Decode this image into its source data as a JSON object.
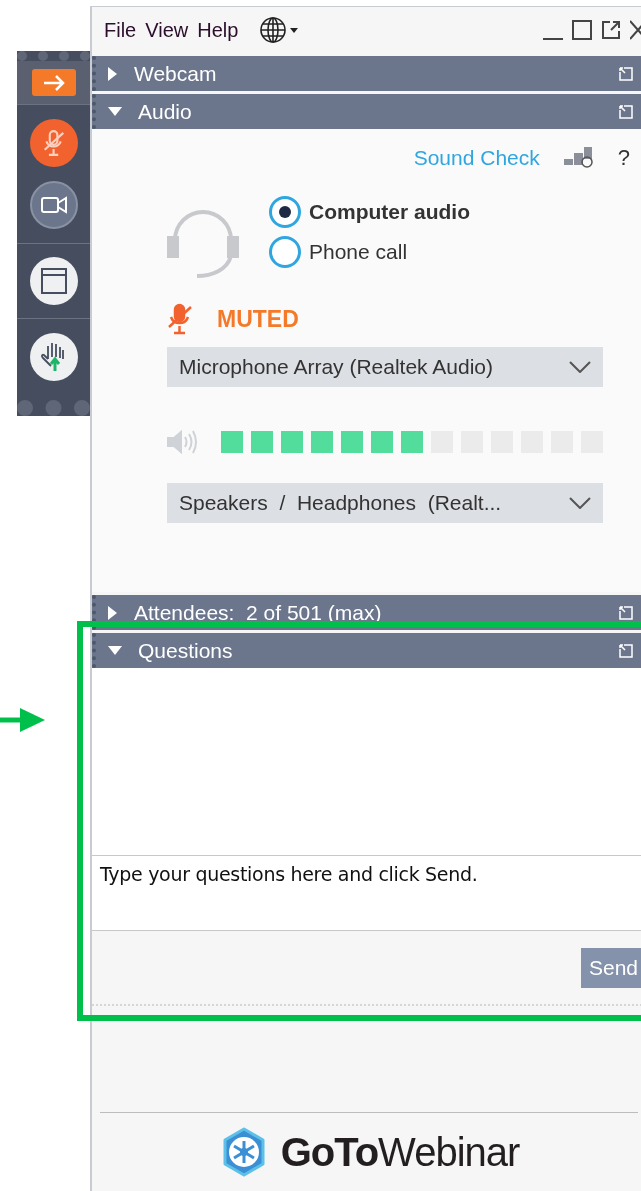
{
  "menu": [
    "File",
    "View",
    "Help"
  ],
  "sections": [
    {
      "title": "Webcam",
      "expanded": false
    },
    {
      "title": "Audio",
      "expanded": true,
      "kind": "audio"
    },
    {
      "title": "Attendees:  2 of 501 (max)",
      "expanded": false
    },
    {
      "title": "Questions",
      "expanded": true,
      "kind": "questions"
    }
  ],
  "audio": {
    "sound_check": "Sound Check",
    "help": "?",
    "modes": [
      {
        "label": "Computer audio",
        "selected": true
      },
      {
        "label": "Phone call",
        "selected": false
      }
    ],
    "mute_status": "MUTED",
    "muted": true,
    "microphone": "Microphone Array (Realtek Audio)",
    "speaker_level": {
      "level": 0.54
    },
    "speakers": "Speakers  /  Headphones  (Realt..."
  },
  "questions": {
    "placeholder": "Type your questions here and click Send.",
    "send": "Send"
  },
  "toolbar": [
    {
      "kind": "mute",
      "on": true
    },
    {
      "kind": "camera",
      "on": false
    },
    {
      "kind": "screen",
      "on": false
    },
    {
      "kind": "hand",
      "on": false
    }
  ],
  "logo": "**GoTo**Webinar"
}
